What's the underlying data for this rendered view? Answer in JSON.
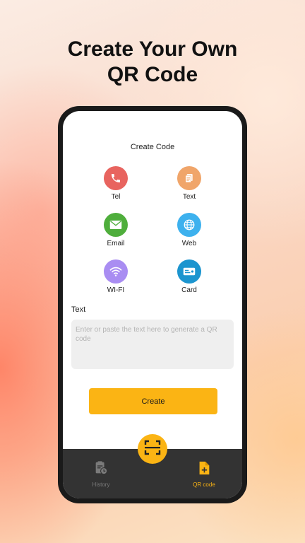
{
  "headline": {
    "line1": "Create Your Own",
    "line2": "QR Code"
  },
  "screen": {
    "title": "Create Code",
    "types": [
      {
        "label": "Tel",
        "icon": "phone-icon",
        "color": "#e8645f"
      },
      {
        "label": "Text",
        "icon": "document-icon",
        "color": "#f0a56a"
      },
      {
        "label": "Email",
        "icon": "mail-icon",
        "color": "#4fae3c"
      },
      {
        "label": "Web",
        "icon": "globe-icon",
        "color": "#3db1ee"
      },
      {
        "label": "WI-FI",
        "icon": "wifi-icon",
        "color": "#a98df2"
      },
      {
        "label": "Card",
        "icon": "card-icon",
        "color": "#1c95cf"
      }
    ],
    "field_label": "Text",
    "input_placeholder": "Enter or paste the text here to generate a QR code",
    "create_label": "Create"
  },
  "bottom_nav": {
    "items": [
      {
        "label": "History",
        "icon": "history-icon",
        "color": "#7a7a7a",
        "active": false
      },
      {
        "label": "QR code",
        "icon": "qr-file-icon",
        "color": "#fbb414",
        "active": true
      }
    ]
  },
  "scan_button": {
    "icon": "scan-icon"
  },
  "colors": {
    "accent": "#fbb414",
    "nav_bg": "#333333"
  }
}
